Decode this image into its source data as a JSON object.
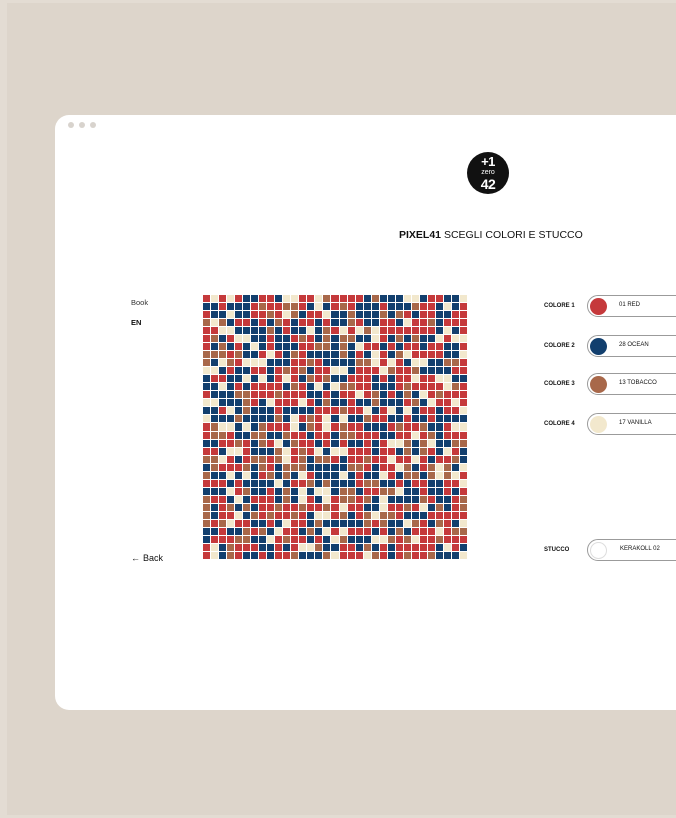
{
  "logo": {
    "line1": "+1",
    "line2": "zero",
    "line3": "42"
  },
  "header": {
    "title_bold": "PIXEL41",
    "title_rest": " SCEGLI COLORI E STUCCO"
  },
  "sidebar": {
    "book": "Book",
    "lang": "EN",
    "back": "Back"
  },
  "colors": [
    {
      "label": "COLORE 1",
      "name": "01 RED",
      "hex": "#c5393b"
    },
    {
      "label": "COLORE 2",
      "name": "28 OCEAN",
      "hex": "#123f6e"
    },
    {
      "label": "COLORE 3",
      "name": "13 TOBACCO",
      "hex": "#a8684a"
    },
    {
      "label": "COLORE 4",
      "name": "17 VANILLA",
      "hex": "#f2e8cd"
    }
  ],
  "stucco": {
    "label": "STUCCO",
    "name": "KERAKOLL 02"
  },
  "colors_ui": {
    "background": "#e3dcd3",
    "window": "#ffffff"
  }
}
